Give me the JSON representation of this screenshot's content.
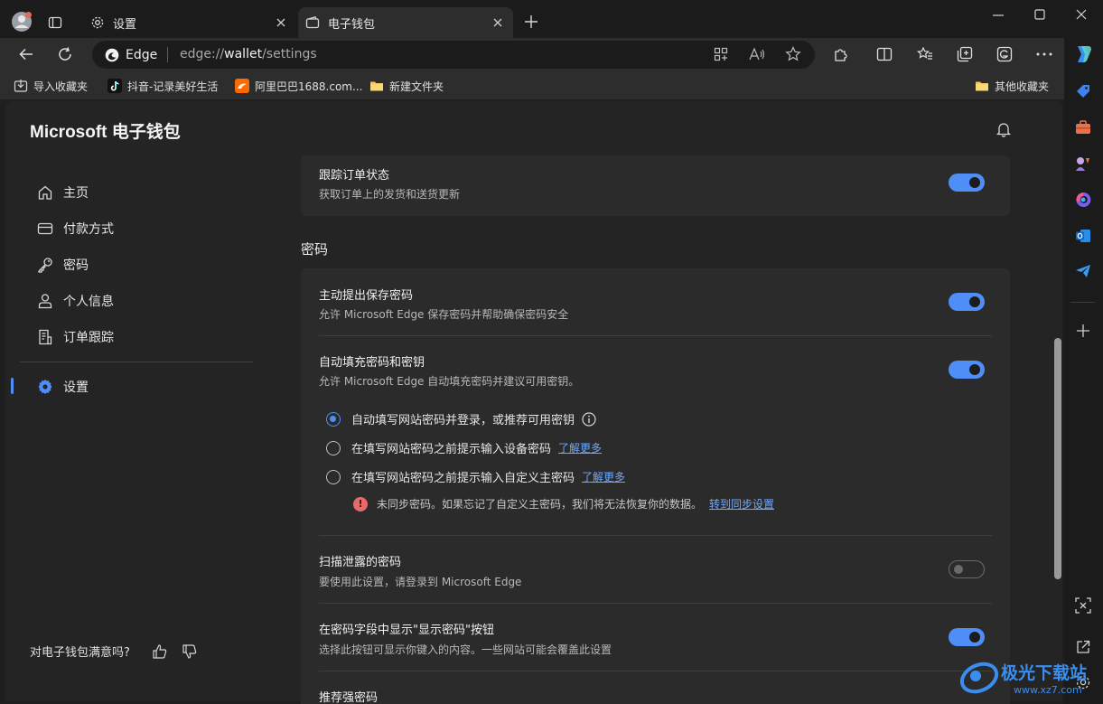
{
  "tabs": [
    {
      "label": "设置",
      "icon": "gear-icon"
    },
    {
      "label": "电子钱包",
      "icon": "wallet-icon"
    }
  ],
  "address": {
    "site": "Edge",
    "url_prefix": "edge://",
    "url_host": "wallet",
    "url_path": "/settings"
  },
  "bookmarks": [
    {
      "label": "导入收藏夹",
      "icon": "import-icon"
    },
    {
      "label": "抖音-记录美好生活",
      "icon": "tiktok-icon"
    },
    {
      "label": "阿里巴巴1688.com...",
      "icon": "alibaba-icon"
    },
    {
      "label": "新建文件夹",
      "icon": "folder-icon"
    },
    {
      "label": "其他收藏夹",
      "icon": "folder-icon"
    }
  ],
  "wallet": {
    "title": "Microsoft 电子钱包",
    "nav": [
      {
        "label": "主页",
        "icon": "home-icon"
      },
      {
        "label": "付款方式",
        "icon": "card-icon"
      },
      {
        "label": "密码",
        "icon": "key-icon"
      },
      {
        "label": "个人信息",
        "icon": "person-icon"
      },
      {
        "label": "订单跟踪",
        "icon": "receipt-icon"
      },
      {
        "label": "设置",
        "icon": "gear-icon"
      }
    ],
    "feedback": "对电子钱包满意吗?"
  },
  "settings": {
    "order_tracking": {
      "title": "跟踪订单状态",
      "desc": "获取订单上的发货和送货更新",
      "enabled": true
    },
    "section_password": "密码",
    "offer_save": {
      "title": "主动提出保存密码",
      "desc": "允许 Microsoft Edge 保存密码并帮助确保密码安全",
      "enabled": true
    },
    "autofill": {
      "title": "自动填充密码和密钥",
      "desc": "允许 Microsoft Edge 自动填充密码并建议可用密钥。",
      "enabled": true
    },
    "autofill_options": [
      {
        "label": "自动填写网站密码并登录，或推荐可用密钥",
        "selected": true,
        "link": ""
      },
      {
        "label": "在填写网站密码之前提示输入设备密码",
        "selected": false,
        "link": "了解更多"
      },
      {
        "label": "在填写网站密码之前提示输入自定义主密码",
        "selected": false,
        "link": "了解更多"
      }
    ],
    "warning": {
      "text": "未同步密码。如果忘记了自定义主密码，我们将无法恢复你的数据。",
      "link": "转到同步设置"
    },
    "leak_scan": {
      "title": "扫描泄露的密码",
      "desc": "要使用此设置，请登录到 Microsoft Edge",
      "enabled": false
    },
    "reveal_button": {
      "title": "在密码字段中显示\"显示密码\"按钮",
      "desc": "选择此按钮可显示你键入的内容。一些网站可能会覆盖此设置",
      "enabled": true
    },
    "strong_password": {
      "title": "推荐强密码"
    }
  },
  "watermark": {
    "text": "极光下载站",
    "url": "www.xz7.com"
  },
  "colors": {
    "accent": "#4f8ef7",
    "link": "#6ea8ff",
    "warning": "#e86a6a"
  }
}
